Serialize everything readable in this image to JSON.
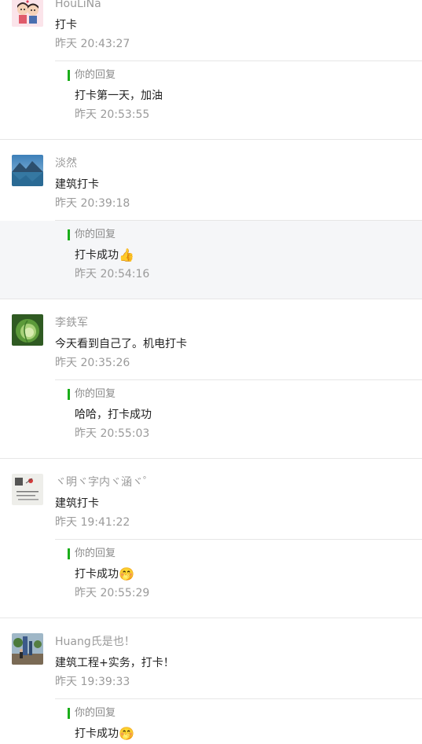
{
  "comments": [
    {
      "nickname": "HouLiNa",
      "avatar": "couple-cartoon-avatar",
      "content": "打卡",
      "time": "昨天 20:43:27",
      "reply": {
        "label": "你的回复",
        "content": "打卡第一天，加油",
        "emoji": "",
        "time": "昨天 20:53:55"
      }
    },
    {
      "nickname": "淡然",
      "avatar": "lake-landscape-avatar",
      "content": "建筑打卡",
      "time": "昨天 20:39:18",
      "reply": {
        "label": "你的回复",
        "content": "打卡成功",
        "emoji": "👍",
        "time": "昨天 20:54:16"
      }
    },
    {
      "nickname": "李鉄军",
      "avatar": "cabbage-avatar",
      "content": "今天看到自己了。机电打卡",
      "time": "昨天 20:35:26",
      "reply": {
        "label": "你的回复",
        "content": "哈哈，打卡成功",
        "emoji": "",
        "time": "昨天 20:55:03"
      }
    },
    {
      "nickname": "ヾ明ヾ字内ヾ涵ヾ゜",
      "avatar": "calligraphy-avatar",
      "content": "建筑打卡",
      "time": "昨天 19:41:22",
      "reply": {
        "label": "你的回复",
        "content": "打卡成功",
        "emoji": "🤭",
        "time": "昨天 20:55:29"
      }
    },
    {
      "nickname": "Huang氏是也！",
      "avatar": "playground-avatar",
      "content": "建筑工程+实务，打卡！",
      "time": "昨天 19:39:33",
      "reply": {
        "label": "你的回复",
        "content": "打卡成功",
        "emoji": "🤭",
        "time": ""
      }
    }
  ],
  "colors": {
    "accent_bar": "#1aad19",
    "highlight_bg": "#f5f6f8",
    "name_text": "#9a9a9a",
    "content_text": "#222222"
  }
}
